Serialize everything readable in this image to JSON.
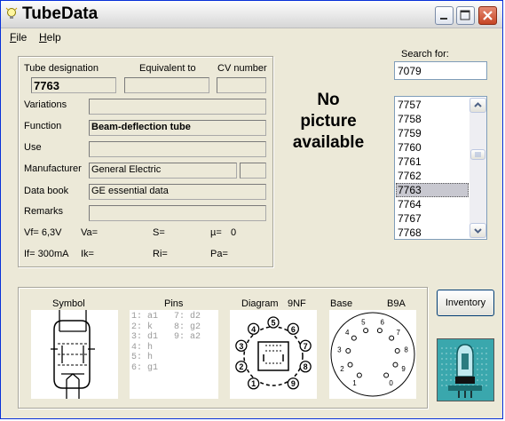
{
  "window": {
    "title": "TubeData"
  },
  "menu": [
    {
      "label": "File",
      "accel": "F"
    },
    {
      "label": "Help",
      "accel": "H"
    }
  ],
  "fields": {
    "designation_label": "Tube designation",
    "designation_value": "7763",
    "equivalent_label": "Equivalent to",
    "equivalent_value": "",
    "cv_label": "CV number",
    "cv_value": "",
    "variations_label": "Variations",
    "variations_value": "",
    "function_label": "Function",
    "function_value": "Beam-deflection tube",
    "use_label": "Use",
    "use_value": "",
    "manufacturer_label": "Manufacturer",
    "manufacturer_value": "General Electric",
    "manufacturer_extra": "",
    "databook_label": "Data book",
    "databook_value": "GE essential data",
    "remarks_label": "Remarks",
    "remarks_value": ""
  },
  "params": {
    "vf": "Vf= 6,3V",
    "va": "Va=",
    "s": "S=",
    "mu_label": "µ=",
    "mu_value": "0",
    "if": "If= 300mA",
    "ik": "Ik=",
    "ri": "Ri=",
    "pa": "Pa="
  },
  "picture": {
    "line1": "No",
    "line2": "picture",
    "line3": "available"
  },
  "search": {
    "label": "Search for:",
    "value": "7079"
  },
  "tube_list": {
    "items": [
      "7757",
      "7758",
      "7759",
      "7760",
      "7761",
      "7762",
      "7763",
      "7764",
      "7767",
      "7768"
    ],
    "selected": "7763"
  },
  "bottom": {
    "symbol_label": "Symbol",
    "pins_label": "Pins",
    "diagram_label": "Diagram",
    "diagram_code": "9NF",
    "base_label": "Base",
    "base_code": "B9A",
    "pins_col1": [
      "1: a1",
      "2: k",
      "3: d1",
      "4: h",
      "5: h",
      "6: g1"
    ],
    "pins_col2": [
      "7: d2",
      "8: g2",
      "9: a2"
    ],
    "diagram_pins": [
      "1",
      "2",
      "3",
      "4",
      "5",
      "6",
      "7",
      "8",
      "9"
    ],
    "base_numbers": [
      "1",
      "2",
      "3",
      "4",
      "5",
      "6",
      "7",
      "8",
      "9",
      "0"
    ]
  },
  "inventory_button": "Inventory"
}
